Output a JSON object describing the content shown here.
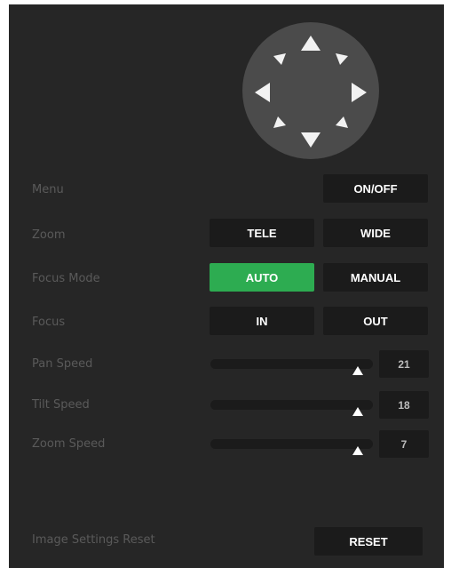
{
  "ptz": {
    "up_icon": "triangle-up",
    "down_icon": "triangle-down",
    "left_icon": "triangle-left",
    "right_icon": "triangle-right",
    "up_left_icon": "triangle-up-left",
    "up_right_icon": "triangle-up-right",
    "down_left_icon": "triangle-down-left",
    "down_right_icon": "triangle-down-right"
  },
  "menu": {
    "label": "Menu",
    "button": "ON/OFF"
  },
  "zoom": {
    "label": "Zoom",
    "tele": "TELE",
    "wide": "WIDE"
  },
  "focus_mode": {
    "label": "Focus Mode",
    "auto": "AUTO",
    "manual": "MANUAL",
    "selected": "AUTO"
  },
  "focus": {
    "label": "Focus",
    "in": "IN",
    "out": "OUT"
  },
  "pan_speed": {
    "label": "Pan Speed",
    "value": "21"
  },
  "tilt_speed": {
    "label": "Tilt Speed",
    "value": "18"
  },
  "zoom_speed": {
    "label": "Zoom Speed",
    "value": "7"
  },
  "reset": {
    "label": "Image Settings Reset",
    "button": "RESET"
  },
  "colors": {
    "panel": "#262626",
    "button": "#1b1b1b",
    "active": "#2dac51",
    "label": "#5a5a5a",
    "joystick": "#4b4b4b"
  }
}
